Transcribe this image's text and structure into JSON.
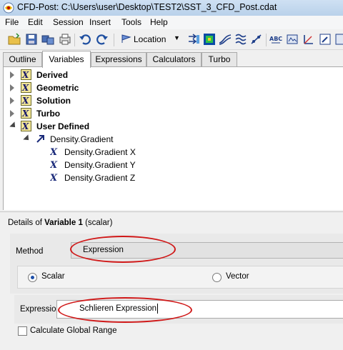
{
  "window": {
    "title": "CFD-Post: C:\\Users\\user\\Desktop\\TEST2\\SST_3_CFD_Post.cdat"
  },
  "menu": [
    "File",
    "Edit",
    "Session",
    "Insert",
    "Tools",
    "Help"
  ],
  "toolbar": {
    "location_label": "Location",
    "icons": [
      "open-folder-icon",
      "save-icon",
      "save-state-icon",
      "print-icon",
      "undo-icon",
      "redo-icon",
      "location-icon",
      "vector-icon",
      "contour-icon",
      "streamline-icon",
      "volume-icon",
      "text-icon",
      "clip-icon",
      "edit-icon"
    ]
  },
  "tabs": [
    "Outline",
    "Variables",
    "Expressions",
    "Calculators",
    "Turbo"
  ],
  "active_tab": "Variables",
  "tree": {
    "groups": [
      "Derived",
      "Geometric",
      "Solution",
      "Turbo",
      "User Defined"
    ],
    "user_variable": "Density.Gradient",
    "children": [
      "Density.Gradient X",
      "Density.Gradient Y",
      "Density.Gradient Z"
    ]
  },
  "details": {
    "title_prefix": "Details of",
    "title_name": "Variable 1",
    "title_suffix": "(scalar)",
    "method_label": "Method",
    "method_value": "Expression",
    "scalar_label": "Scalar",
    "vector_label": "Vector",
    "selected_type": "Scalar",
    "expression_label": "Expression",
    "expression_value": "Schlieren Expression",
    "calc_global_range_label": "Calculate Global Range",
    "calc_global_range_checked": false
  },
  "annotation_color": "#d01818"
}
